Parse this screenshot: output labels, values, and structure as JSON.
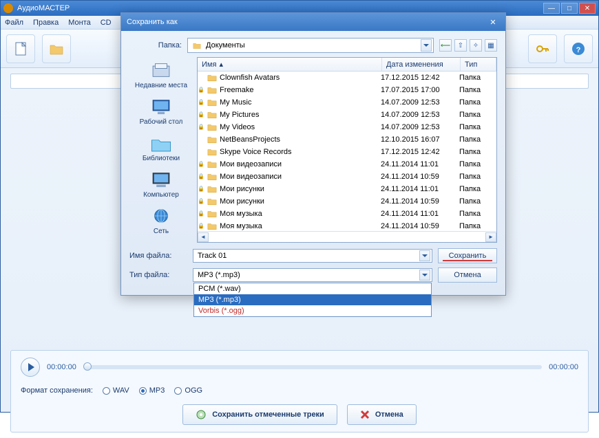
{
  "app": {
    "title": "АудиоМАСТЕР",
    "menubar": [
      "Файл",
      "Правка",
      "Монта",
      "CD"
    ]
  },
  "player": {
    "time_start": "00:00:00",
    "time_end": "00:00:00",
    "format_label": "Формат сохранения:",
    "formats": [
      "WAV",
      "MP3",
      "OGG"
    ],
    "format_selected": "MP3",
    "save_button": "Сохранить отмеченные треки",
    "cancel_button": "Отмена"
  },
  "dialog": {
    "title": "Сохранить как",
    "folder_label": "Папка:",
    "folder_value": "Документы",
    "places": [
      {
        "label": "Недавние места",
        "kind": "recent"
      },
      {
        "label": "Рабочий стол",
        "kind": "desktop"
      },
      {
        "label": "Библиотеки",
        "kind": "libraries"
      },
      {
        "label": "Компьютер",
        "kind": "computer"
      },
      {
        "label": "Сеть",
        "kind": "network"
      }
    ],
    "columns": {
      "name": "Имя",
      "date": "Дата изменения",
      "type": "Тип"
    },
    "files": [
      {
        "name": "Clownfish Avatars",
        "date": "17.12.2015 12:42",
        "type": "Папка",
        "locked": false
      },
      {
        "name": "Freemake",
        "date": "17.07.2015 17:00",
        "type": "Папка",
        "locked": true
      },
      {
        "name": "My Music",
        "date": "14.07.2009 12:53",
        "type": "Папка",
        "locked": true
      },
      {
        "name": "My Pictures",
        "date": "14.07.2009 12:53",
        "type": "Папка",
        "locked": true
      },
      {
        "name": "My Videos",
        "date": "14.07.2009 12:53",
        "type": "Папка",
        "locked": true
      },
      {
        "name": "NetBeansProjects",
        "date": "12.10.2015 16:07",
        "type": "Папка",
        "locked": false
      },
      {
        "name": "Skype Voice Records",
        "date": "17.12.2015 12:42",
        "type": "Папка",
        "locked": false
      },
      {
        "name": "Мои видеозаписи",
        "date": "24.11.2014 11:01",
        "type": "Папка",
        "locked": true
      },
      {
        "name": "Мои видеозаписи",
        "date": "24.11.2014 10:59",
        "type": "Папка",
        "locked": true
      },
      {
        "name": "Мои рисунки",
        "date": "24.11.2014 11:01",
        "type": "Папка",
        "locked": true
      },
      {
        "name": "Мои рисунки",
        "date": "24.11.2014 10:59",
        "type": "Папка",
        "locked": true
      },
      {
        "name": "Моя музыка",
        "date": "24.11.2014 11:01",
        "type": "Папка",
        "locked": true
      },
      {
        "name": "Моя музыка",
        "date": "24.11.2014 10:59",
        "type": "Папка",
        "locked": true
      }
    ],
    "filename_label": "Имя файла:",
    "filename_value": "Track 01",
    "filetype_label": "Тип файла:",
    "filetype_value": "MP3 (*.mp3)",
    "filetype_options": [
      "PCM (*.wav)",
      "MP3 (*.mp3)",
      "Vorbis (*.ogg)"
    ],
    "filetype_selected_index": 1,
    "save_label": "Сохранить",
    "cancel_label": "Отмена"
  }
}
